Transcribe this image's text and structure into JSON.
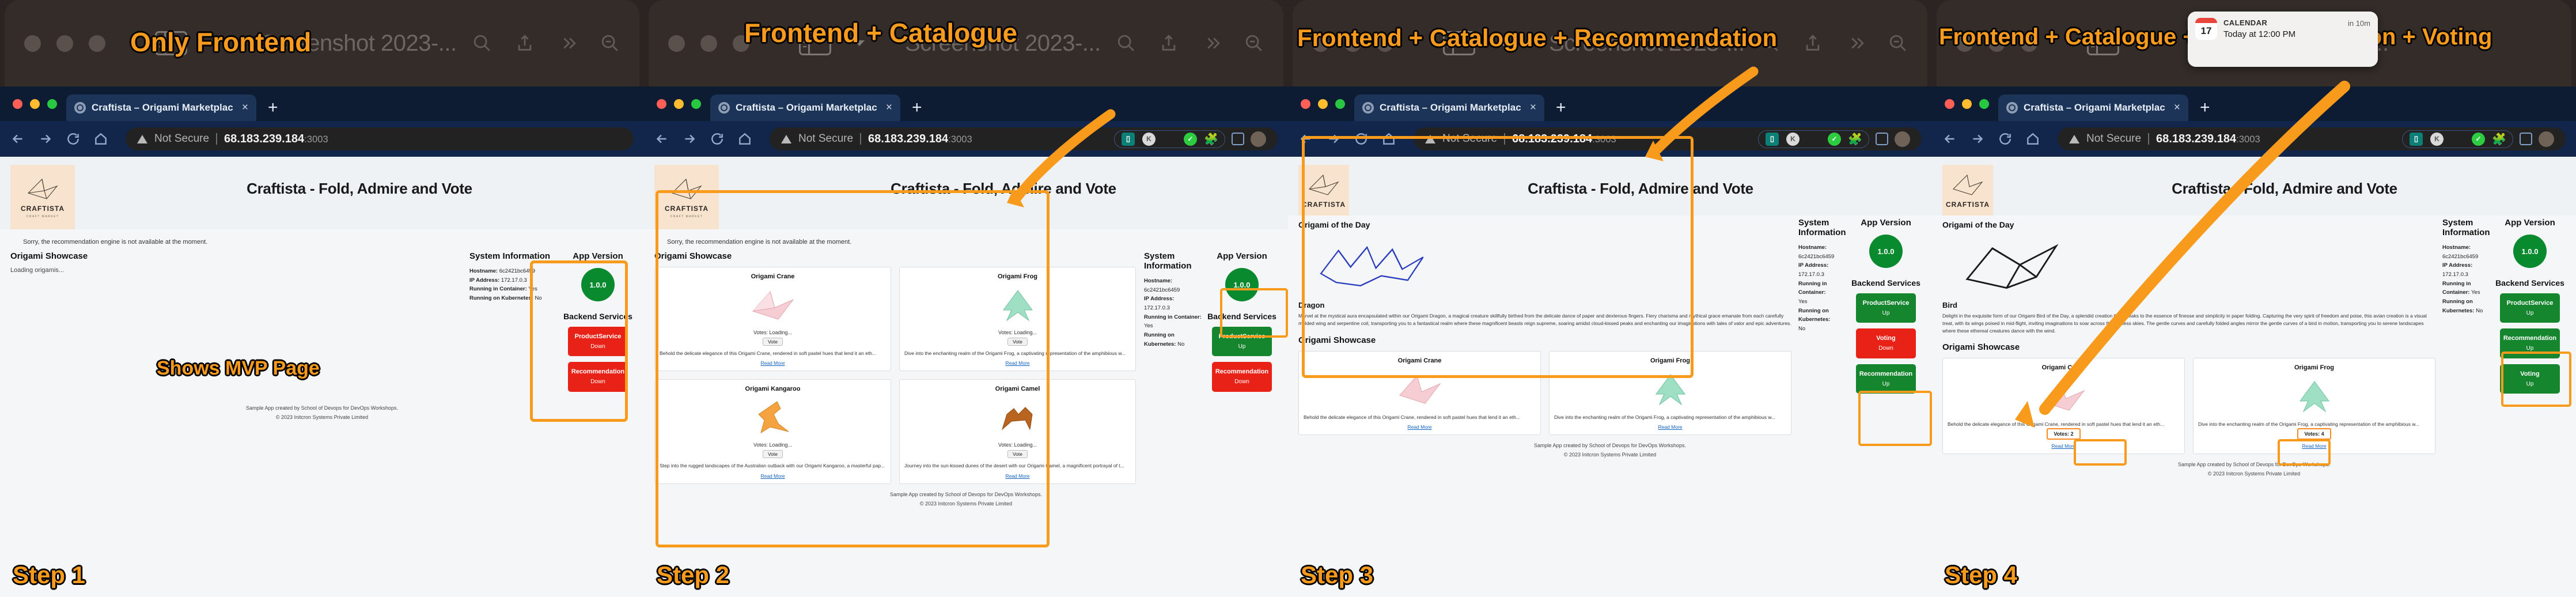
{
  "meta": {
    "macos_window_title": "Screenshot 2023-...",
    "calendar_toast": {
      "app": "CALENDAR",
      "body": "Today at 12:00 PM",
      "time": "in 10m",
      "icon": "calendar-icon",
      "day": "17"
    },
    "accent_color": "#f89a1c",
    "status_up_color": "#16862e",
    "status_down_color": "#e82216"
  },
  "browser": {
    "tab_title": "Craftista – Origami Marketplac",
    "security_label": "Not Secure",
    "url_host": "68.183.239.184",
    "url_port": ":3003",
    "new_tab_label": "+",
    "close_tab_label": "×"
  },
  "site": {
    "title": "Craftista - Fold, Admire and Vote",
    "brand_name": "CRAFTISTA",
    "brand_sub": "CRAFT MARKET",
    "notice_unavailable": "Sorry, the recommendation engine is not available at the moment.",
    "headings": {
      "showcase": "Origami Showcase",
      "system_info": "System Information",
      "app_version": "App Version",
      "backend_services": "Backend Services",
      "origami_of_day": "Origami of the Day"
    },
    "loading_text": "Loading origamis...",
    "app_version": "1.0.0",
    "system_info": [
      {
        "label": "Hostname:",
        "value": "6c2421bc6459"
      },
      {
        "label": "IP Address:",
        "value": "172.17.0.3"
      },
      {
        "label": "Running in Container:",
        "value": "Yes"
      },
      {
        "label": "Running on Kubernetes:",
        "value": "No"
      }
    ],
    "footer_line1": "Sample App created by School of Devops for DevOps Workshops.",
    "footer_line2": "© 2023 Initcron Systems Private Limited",
    "read_more": "Read More",
    "vote_button_label": "Vote",
    "votes_loading": "Votes: Loading..."
  },
  "services": {
    "step1": [
      {
        "name": "ProductService",
        "status": "Down",
        "state": "down"
      },
      {
        "name": "Recommendation",
        "status": "Down",
        "state": "down"
      }
    ],
    "step2": [
      {
        "name": "ProductService",
        "status": "Up",
        "state": "up"
      },
      {
        "name": "Recommendation",
        "status": "Down",
        "state": "down"
      }
    ],
    "step3": [
      {
        "name": "ProductService",
        "status": "Up",
        "state": "up"
      },
      {
        "name": "Voting",
        "status": "Down",
        "state": "down"
      },
      {
        "name": "Recommendation",
        "status": "Up",
        "state": "up"
      }
    ],
    "step4": [
      {
        "name": "ProductService",
        "status": "Up",
        "state": "up"
      },
      {
        "name": "Recommendation",
        "status": "Up",
        "state": "up"
      },
      {
        "name": "Voting",
        "status": "Up",
        "state": "up"
      }
    ]
  },
  "origami_of_day": {
    "step3": {
      "name": "Dragon",
      "description": "Marvel at the mystical aura encapsulated within our Origami Dragon, a magical creature skillfully birthed from the delicate dance of paper and dexterous fingers. Fiery charisma and mythical grace emanate from each carefully molded wing and serpentine coil, transporting you to a fantastical realm where these magnificent beasts reign supreme, soaring amidst cloud-kissed peaks and enchanting our imaginations with tales of valor and epic adventures."
    },
    "step4": {
      "name": "Bird",
      "description": "Delight in the exquisite form of our Origami Bird of the Day, a splendid creation that speaks to the essence of finesse and simplicity in paper folding. Capturing the very spirit of freedom and poise, this avian creation is a visual treat, with its wings poised in mid-flight, inviting imaginations to soar across the endless skies. The gentle curves and carefully folded angles mirror the gentle curves of a bird in motion, transporting you to serene landscapes where these ethereal creatures dance with the wind."
    }
  },
  "showcase_cards": {
    "step2": [
      {
        "name": "Origami Crane",
        "art": "crane-origami-icon",
        "votes": "Votes: Loading...",
        "button": "Vote",
        "desc": "Behold the delicate elegance of this Origami Crane, rendered in soft pastel hues that lend it an eth...",
        "link": "Read More"
      },
      {
        "name": "Origami Frog",
        "art": "frog-origami-icon",
        "votes": "Votes: Loading...",
        "button": "Vote",
        "desc": "Dive into the enchanting realm of the Origami Frog, a captivating representation of the amphibious w...",
        "link": "Read More"
      },
      {
        "name": "Origami Kangaroo",
        "art": "kangaroo-origami-icon",
        "votes": "Votes: Loading...",
        "button": "Vote",
        "desc": "Step into the rugged landscapes of the Australian outback with our Origami Kangaroo, a masterful pap...",
        "link": "Read More"
      },
      {
        "name": "Origami Camel",
        "art": "camel-origami-icon",
        "votes": "Votes: Loading...",
        "button": "Vote",
        "desc": "Journey into the sun-kissed dunes of the desert with our Origami Camel, a magnificent portrayal of t...",
        "link": "Read More"
      }
    ],
    "step3": [
      {
        "name": "Origami Crane",
        "art": "crane-origami-icon",
        "votes": "",
        "button": "",
        "desc": "Behold the delicate elegance of this Origami Crane, rendered in soft pastel hues that lend it an eth...",
        "link": "Read More"
      },
      {
        "name": "Origami Frog",
        "art": "frog-origami-icon",
        "votes": "",
        "button": "",
        "desc": "Dive into the enchanting realm of the Origami Frog, a captivating representation of the amphibious w...",
        "link": "Read More"
      }
    ],
    "step4": [
      {
        "name": "Origami Crane",
        "art": "crane-origami-icon",
        "votes": "Votes: 2",
        "button": "",
        "desc": "Behold the delicate elegance of this Origami Crane, rendered in soft pastel hues that lend it an eth...",
        "link": "Read More"
      },
      {
        "name": "Origami Frog",
        "art": "frog-origami-icon",
        "votes": "Votes: 4",
        "button": "",
        "desc": "Dive into the enchanting realm of the Origami Frog, a captivating representation of the amphibious w...",
        "link": "Read More"
      }
    ]
  },
  "annotations": {
    "step1": {
      "title": "Only Frontend",
      "note": "Shows MVP Page",
      "step": "Step 1"
    },
    "step2": {
      "title": "Frontend + Catalogue",
      "step": "Step 2"
    },
    "step3": {
      "title": "Frontend + Catalogue + Recommendation",
      "step": "Step 3"
    },
    "step4": {
      "title": "Frontend + Catalogue + Recommendation + Voting",
      "step": "Step 4"
    }
  }
}
